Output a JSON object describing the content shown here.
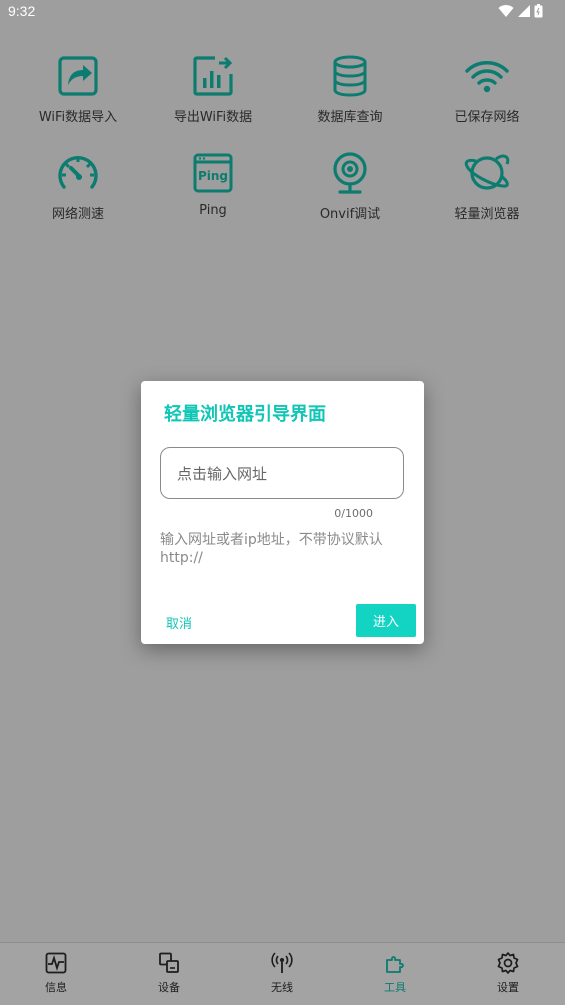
{
  "status_bar": {
    "time": "9:32"
  },
  "tools": [
    {
      "label": "WiFi数据导入",
      "icon": "import-share-icon"
    },
    {
      "label": "导出WiFi数据",
      "icon": "export-chart-icon"
    },
    {
      "label": "数据库查询",
      "icon": "database-icon"
    },
    {
      "label": "已保存网络",
      "icon": "wifi-icon"
    },
    {
      "label": "网络测速",
      "icon": "speedometer-icon"
    },
    {
      "label": "Ping",
      "icon": "ping-window-icon",
      "inner_text": "Ping"
    },
    {
      "label": "Onvif调试",
      "icon": "webcam-icon"
    },
    {
      "label": "轻量浏览器",
      "icon": "planet-icon"
    }
  ],
  "dialog": {
    "title": "轻量浏览器引导界面",
    "input_placeholder": "点击输入网址",
    "input_value": "",
    "counter": "0/1000",
    "hint": "输入网址或者ip地址，不带协议默认http://",
    "cancel_label": "取消",
    "enter_label": "进入"
  },
  "bottom_nav": {
    "items": [
      {
        "label": "信息",
        "icon": "pulse-monitor-icon",
        "active": false
      },
      {
        "label": "设备",
        "icon": "devices-icon",
        "active": false
      },
      {
        "label": "无线",
        "icon": "antenna-icon",
        "active": false
      },
      {
        "label": "工具",
        "icon": "puzzle-icon",
        "active": true
      },
      {
        "label": "设置",
        "icon": "gear-icon",
        "active": false
      }
    ]
  },
  "colors": {
    "accent": "#13D3C3",
    "icon_teal": "#0B7C6F",
    "overlay": "#9E9E9E"
  }
}
